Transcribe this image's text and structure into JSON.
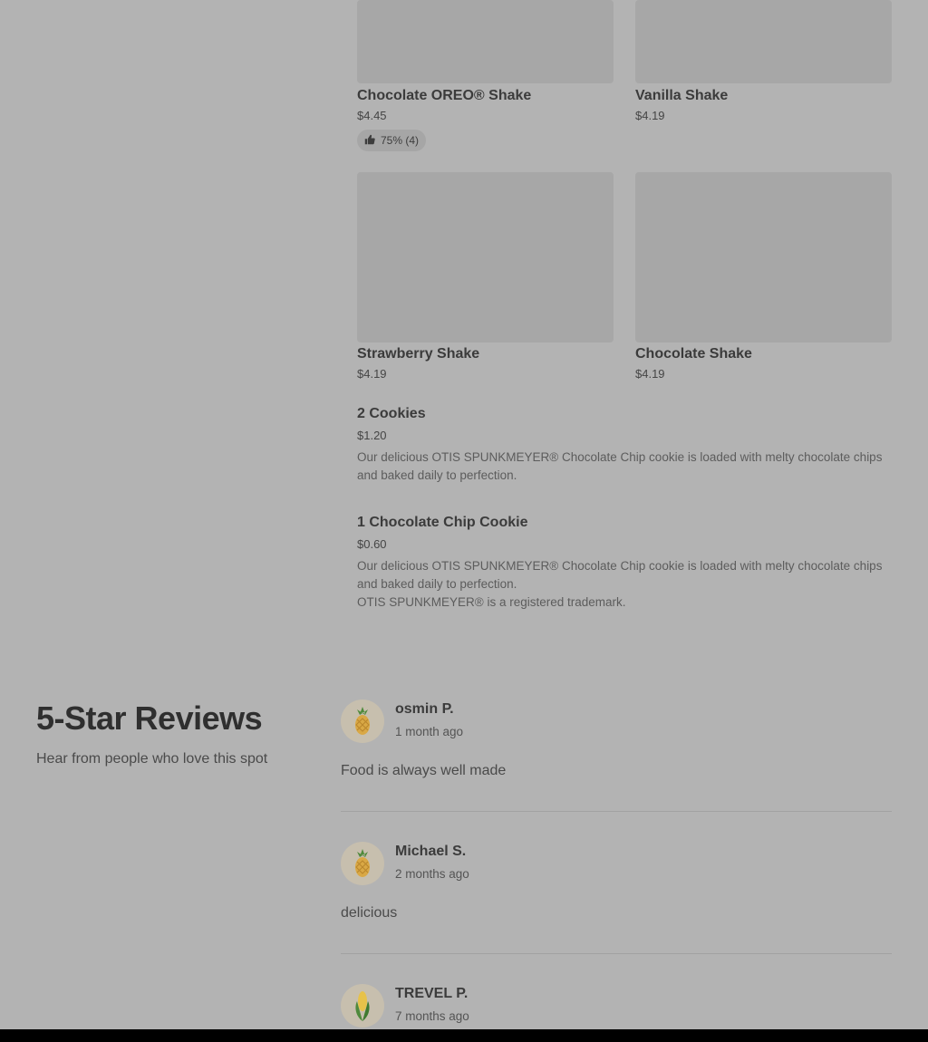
{
  "menu": {
    "grid_items": [
      {
        "name": "Chocolate OREO® Shake",
        "price": "$4.45",
        "rating": "75% (4)"
      },
      {
        "name": "Vanilla Shake",
        "price": "$4.19"
      },
      {
        "name": "Strawberry Shake",
        "price": "$4.19"
      },
      {
        "name": "Chocolate Shake",
        "price": "$4.19"
      }
    ],
    "list_items": [
      {
        "name": "2 Cookies",
        "price": "$1.20",
        "description": "Our delicious OTIS SPUNKMEYER® Chocolate Chip cookie is loaded with melty chocolate chips and baked daily to perfection."
      },
      {
        "name": "1 Chocolate Chip Cookie",
        "price": "$0.60",
        "description": "Our delicious OTIS SPUNKMEYER® Chocolate Chip cookie is loaded with melty chocolate chips and baked daily to perfection.",
        "note": "OTIS SPUNKMEYER® is a registered trademark."
      }
    ]
  },
  "reviews": {
    "title": "5-Star Reviews",
    "subtitle": "Hear from people who love this spot",
    "items": [
      {
        "name": "osmin P.",
        "date": "1 month ago",
        "text": "Food is always well made",
        "avatar_icon": "pineapple-icon"
      },
      {
        "name": "Michael S.",
        "date": "2 months ago",
        "text": "delicious",
        "avatar_icon": "pineapple-icon"
      },
      {
        "name": "TREVEL P.",
        "date": "7 months ago",
        "text": "",
        "avatar_icon": "corn-icon"
      }
    ]
  },
  "colors": {
    "overlay_bg": "#b3b3b3",
    "image_placeholder": "#a7a7a7",
    "avatar_bg": "#c7bfae"
  }
}
